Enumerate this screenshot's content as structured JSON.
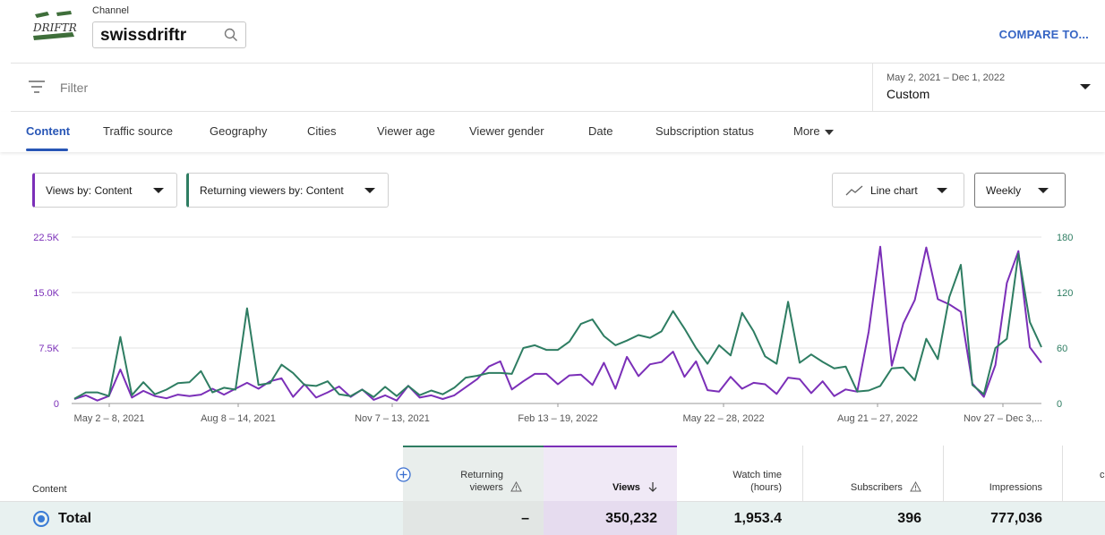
{
  "header": {
    "channel_label": "Channel",
    "channel_name": "swissdriftr",
    "logo_text": "DRIFTR",
    "compare_label": "COMPARE TO..."
  },
  "filter": {
    "placeholder": "Filter"
  },
  "date": {
    "range": "May 2, 2021 – Dec 1, 2022",
    "type": "Custom"
  },
  "tabs": [
    {
      "label": "Content",
      "active": true
    },
    {
      "label": "Traffic source"
    },
    {
      "label": "Geography"
    },
    {
      "label": "Cities"
    },
    {
      "label": "Viewer age"
    },
    {
      "label": "Viewer gender"
    },
    {
      "label": "Date"
    },
    {
      "label": "Subscription status"
    },
    {
      "label": "More"
    }
  ],
  "selectors": {
    "metric1": "Views by: Content",
    "metric2": "Returning viewers by: Content",
    "chart_type": "Line chart",
    "interval": "Weekly"
  },
  "colors": {
    "views": "#7b2fb8",
    "returning": "#2e7d62",
    "accent": "#2856b6"
  },
  "chart_data": {
    "type": "line",
    "x_tick_labels": [
      "May 2 – 8, 2021",
      "Aug 8 – 14, 2021",
      "Nov 7 – 13, 2021",
      "Feb 13 – 19, 2022",
      "May 22 – 28, 2022",
      "Aug 21 – 27, 2022",
      "Nov 27 – Dec 3,..."
    ],
    "y_left_ticks": [
      "22.5K",
      "15.0K",
      "7.5K",
      "0"
    ],
    "y_right_ticks": [
      "180",
      "120",
      "60",
      "0"
    ],
    "y_left_range": [
      0,
      22500
    ],
    "y_right_range": [
      0,
      180
    ],
    "grid": true,
    "series": [
      {
        "axis": "left",
        "color": "#7b2fb8",
        "values": [
          600,
          1100,
          400,
          1000,
          4600,
          800,
          1700,
          1000,
          700,
          1200,
          1000,
          1200,
          2000,
          1200,
          2000,
          2800,
          2000,
          3000,
          3400,
          900,
          2600,
          800,
          1500,
          2300,
          900,
          1900,
          500,
          1100,
          400,
          2400,
          800,
          1100,
          600,
          1100,
          2200,
          3300,
          5000,
          5700,
          1900,
          3000,
          4000,
          4000,
          2600,
          3800,
          3900,
          2500,
          5500,
          2000,
          6300,
          3700,
          5300,
          5600,
          7000,
          3600,
          5700,
          1800,
          1600,
          3600,
          2000,
          2800,
          2600,
          1300,
          3500,
          3300,
          1400,
          3000,
          1000,
          1900,
          1600,
          9700,
          21200,
          5100,
          10800,
          14000,
          21100,
          14100,
          13400,
          12400,
          2700,
          900,
          5200,
          16300,
          20600,
          7600,
          5500
        ]
      },
      {
        "axis": "right",
        "color": "#2e7d62",
        "values": [
          5,
          12,
          12,
          8,
          72,
          9,
          23,
          10,
          15,
          22,
          23,
          35,
          12,
          17,
          15,
          103,
          20,
          22,
          42,
          33,
          20,
          19,
          24,
          10,
          8,
          15,
          7,
          18,
          8,
          19,
          9,
          14,
          10,
          17,
          28,
          30,
          33,
          33,
          32,
          60,
          63,
          58,
          58,
          67,
          86,
          91,
          73,
          63,
          68,
          74,
          71,
          78,
          100,
          81,
          60,
          43,
          63,
          52,
          98,
          78,
          51,
          43,
          110,
          44,
          53,
          45,
          38,
          40,
          13,
          14,
          19,
          38,
          39,
          25,
          70,
          48,
          115,
          150,
          20,
          10,
          60,
          70,
          162,
          88,
          61
        ]
      }
    ]
  },
  "table": {
    "headers": {
      "content": "Content",
      "returning_l1": "Returning",
      "returning_l2": "viewers",
      "views": "Views",
      "watch_l1": "Watch time",
      "watch_l2": "(hours)",
      "subscribers": "Subscribers",
      "impressions": "Impressions",
      "extra": "c"
    },
    "total": {
      "label": "Total",
      "returning": "–",
      "views": "350,232",
      "watch_time": "1,953.4",
      "subscribers": "396",
      "impressions": "777,036"
    }
  }
}
